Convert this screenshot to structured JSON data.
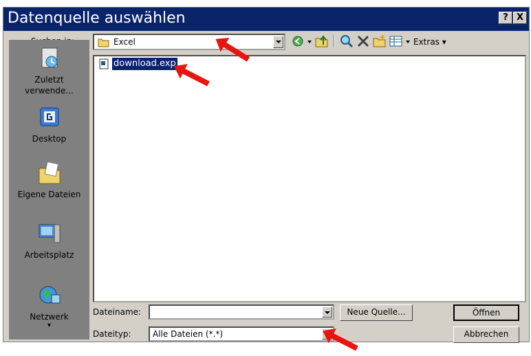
{
  "window": {
    "title": "Datenquelle auswählen",
    "help_button": "?",
    "close_button": "X"
  },
  "toolbar": {
    "look_in_label": "Suchen in:",
    "look_in_value": "Excel",
    "extras_label": "Extras"
  },
  "places": [
    {
      "label_line1": "Zuletzt",
      "label_line2": "verwende...",
      "icon": "history-icon"
    },
    {
      "label_line1": "Desktop",
      "label_line2": "",
      "icon": "desktop-icon"
    },
    {
      "label_line1": "Eigene Dateien",
      "label_line2": "",
      "icon": "my-documents-icon"
    },
    {
      "label_line1": "Arbeitsplatz",
      "label_line2": "",
      "icon": "my-computer-icon"
    },
    {
      "label_line1": "Netzwerk",
      "label_line2": "",
      "icon": "network-icon"
    }
  ],
  "files": [
    {
      "name": "download.exp",
      "selected": true
    }
  ],
  "footer": {
    "filename_label": "Dateiname:",
    "filename_value": "",
    "filetype_label": "Dateityp:",
    "filetype_value": "Alle Dateien (*.*)",
    "new_source_button": "Neue Quelle...",
    "open_button": "Öffnen",
    "cancel_button": "Abbrechen"
  },
  "colors": {
    "titlebar": "#0a246a",
    "dialog": "#d4d0c8",
    "selection": "#0a246a",
    "annotation_arrow": "#e8150f"
  }
}
